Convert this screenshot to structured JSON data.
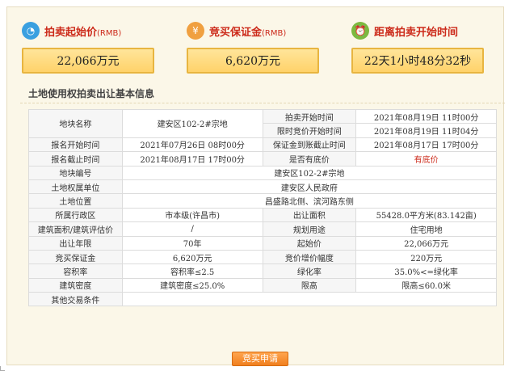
{
  "cards": {
    "start_price": {
      "title": "拍卖起始价",
      "unit": "(RMB)",
      "value": "22,066万元",
      "icon": "clock-coin-icon",
      "color": "#3aa0e0"
    },
    "deposit": {
      "title": "竞买保证金",
      "unit": "(RMB)",
      "value": "6,620万元",
      "icon": "money-bag-icon",
      "color": "#f0a040"
    },
    "countdown": {
      "title": "距离拍卖开始时间",
      "unit": "",
      "value": "22天1小时48分32秒",
      "icon": "alarm-clock-icon",
      "color": "#7cb940"
    }
  },
  "section": {
    "title": "土地使用权拍卖出让基本信息"
  },
  "table": {
    "land_name_label": "地块名称",
    "land_name": "建安区102-2#宗地",
    "auction_start_label": "拍卖开始时间",
    "auction_start": "2021年08月19日 11时00分",
    "bid_start_label": "限时竞价开始时间",
    "bid_start": "2021年08月19日 11时04分",
    "reg_start_label": "报名开始时间",
    "reg_start": "2021年07月26日 08时00分",
    "deposit_deadline_label": "保证金到账截止时间",
    "deposit_deadline": "2021年08月17日 17时00分",
    "reg_end_label": "报名截止时间",
    "reg_end": "2021年08月17日 17时00分",
    "reserve_label": "是否有底价",
    "reserve": "有底价",
    "land_no_label": "地块编号",
    "land_no": "建安区102-2#宗地",
    "owner_label": "土地权属单位",
    "owner": "建安区人民政府",
    "location_label": "土地位置",
    "location": "昌盛路北侧、滨河路东侧",
    "district_label": "所属行政区",
    "district": "市本级(许昌市)",
    "area_label": "出让面积",
    "area": "55428.0平方米(83.142亩)",
    "build_area_label": "建筑面积/建筑评估价",
    "build_area": "/",
    "use_label": "规划用途",
    "use": "住宅用地",
    "term_label": "出让年限",
    "term": "70年",
    "start_price_label": "起始价",
    "start_price": "22,066万元",
    "deposit_label": "竞买保证金",
    "deposit": "6,620万元",
    "increment_label": "竞价增价幅度",
    "increment": "220万元",
    "far_label": "容积率",
    "far": "容积率≤2.5",
    "green_label": "绿化率",
    "green": "35.0%<=绿化率",
    "density_label": "建筑密度",
    "density": "建筑密度≤25.0%",
    "height_label": "限高",
    "height": "限高≤60.0米",
    "other_label": "其他交易条件",
    "other": ""
  },
  "apply_button": "竞买申请"
}
